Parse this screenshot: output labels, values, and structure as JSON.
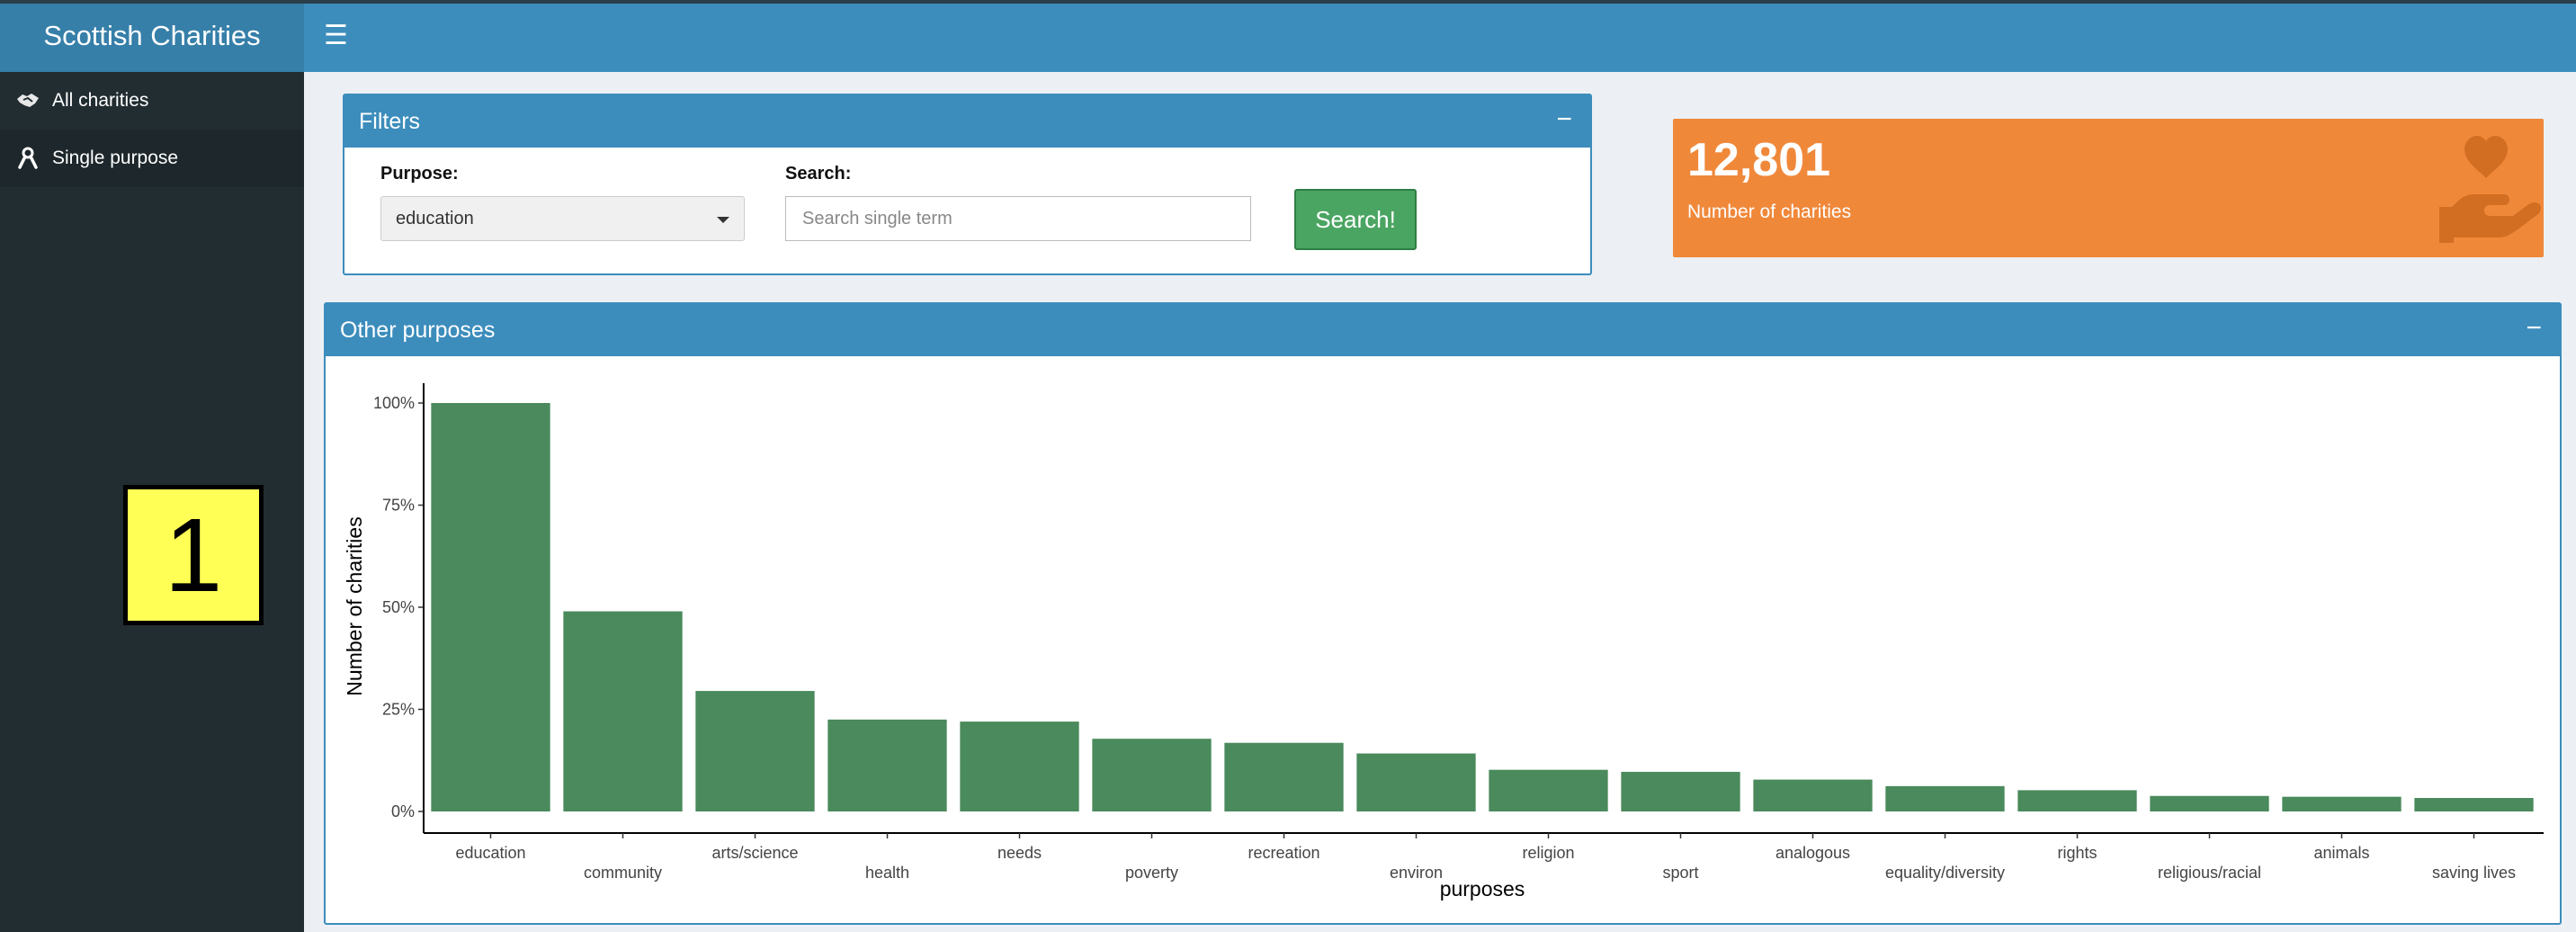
{
  "app": {
    "title": "Scottish Charities"
  },
  "sidebar": {
    "items": [
      {
        "label": "All charities",
        "icon": "handshake-icon"
      },
      {
        "label": "Single purpose",
        "icon": "ribbon-icon",
        "active": true
      }
    ],
    "badge": "1"
  },
  "filters": {
    "title": "Filters",
    "purpose_label": "Purpose:",
    "purpose_value": "education",
    "search_label": "Search:",
    "search_placeholder": "Search single term",
    "search_value": "",
    "search_button": "Search!"
  },
  "valuebox": {
    "value": "12,801",
    "label": "Number of charities",
    "icon": "hand-holding-heart-icon",
    "color": "#f0883a"
  },
  "purposes_box": {
    "title": "Other purposes"
  },
  "colors": {
    "header": "#3c8dbc",
    "sidebar": "#222d32",
    "bar": "#4a8a5c",
    "button": "#4aa562"
  },
  "chart_data": {
    "type": "bar",
    "categories": [
      "education",
      "community",
      "arts/science",
      "health",
      "needs",
      "poverty",
      "recreation",
      "environ",
      "religion",
      "sport",
      "analogous",
      "equality/diversity",
      "rights",
      "religious/racial",
      "animals",
      "saving lives"
    ],
    "values": [
      100,
      49,
      29.5,
      22.5,
      22,
      17.8,
      16.8,
      14.2,
      10.2,
      9.7,
      7.8,
      6.2,
      5.2,
      3.8,
      3.6,
      3.3
    ],
    "yticks": [
      "0%",
      "25%",
      "50%",
      "75%",
      "100%"
    ],
    "ylim": [
      0,
      100
    ],
    "xlabel": "purposes",
    "ylabel": "Number of charities",
    "grid": false,
    "bar_color": "#4a8a5c"
  }
}
